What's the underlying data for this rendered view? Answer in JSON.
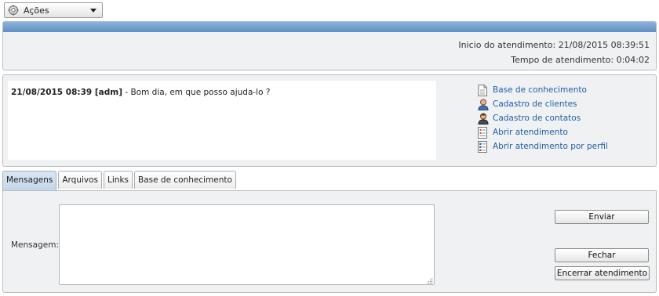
{
  "actions_menu": {
    "label": "Ações",
    "icon": "gear-icon"
  },
  "header": {
    "start_label": "Inicio do atendimento:",
    "start_value": "21/08/2015 08:39:51",
    "duration_label": "Tempo de atendimento:",
    "duration_value": "0:04:02",
    "bar_color": "#6f9ccd"
  },
  "chat": {
    "messages": [
      {
        "meta": "21/08/2015 08:39 [adm]",
        "text": " - Bom dia, em que posso ajuda-lo ?"
      }
    ]
  },
  "links": [
    {
      "label": "Base de conhecimento",
      "icon": "document-icon"
    },
    {
      "label": "Cadastro de clientes",
      "icon": "user-icon"
    },
    {
      "label": "Cadastro de contatos",
      "icon": "contact-user-icon"
    },
    {
      "label": "Abrir atendimento",
      "icon": "form-icon"
    },
    {
      "label": "Abrir atendimento por perfil",
      "icon": "list-form-icon"
    }
  ],
  "tabs": [
    {
      "label": "Mensagens",
      "active": true
    },
    {
      "label": "Arquivos",
      "active": false
    },
    {
      "label": "Links",
      "active": false
    },
    {
      "label": "Base de conhecimento",
      "active": false
    }
  ],
  "message_form": {
    "label": "Mensagem:",
    "value": "",
    "send_label": "Enviar",
    "close_label": "Fechar",
    "end_label": "Encerrar atendimento"
  },
  "colors": {
    "link": "#1f5fa8",
    "panel_bg": "#eff1f2",
    "active_tab": "#c9daec"
  }
}
